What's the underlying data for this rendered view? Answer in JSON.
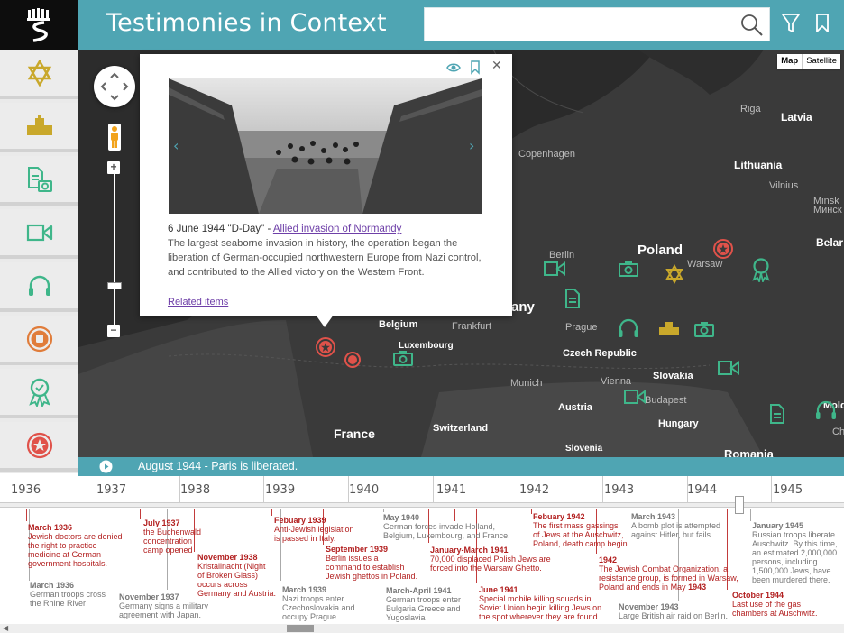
{
  "header": {
    "title": "Testimonies in Context",
    "search_placeholder": ""
  },
  "sidebar": {
    "items": [
      {
        "icon": "star-of-david-icon"
      },
      {
        "icon": "building-icon"
      },
      {
        "icon": "document-photo-icon"
      },
      {
        "icon": "video-icon"
      },
      {
        "icon": "headphones-icon"
      },
      {
        "icon": "fist-badge-icon"
      },
      {
        "icon": "ribbon-award-icon"
      },
      {
        "icon": "star-badge-icon"
      }
    ]
  },
  "map": {
    "toggle": {
      "map": "Map",
      "satellite": "Satellite"
    },
    "labels": {
      "riga": "Riga",
      "latvia": "Latvia",
      "copenhagen": "Copenhagen",
      "lithuania": "Lithuania",
      "vilnius": "Vilnius",
      "minsk": "Minsk",
      "minsk_ru": "Минск",
      "belarus": "Belar",
      "berlin": "Berlin",
      "poland": "Poland",
      "warsaw": "Warsaw",
      "germany": "any",
      "belgium": "Belgium",
      "frankfurt": "Frankfurt",
      "prague": "Prague",
      "luxembourg": "Luxembourg",
      "czech": "Czech Republic",
      "slovakia": "Slovakia",
      "munich": "Munich",
      "vienna": "Vienna",
      "budapest": "Budapest",
      "austria": "Austria",
      "hungary": "Hungary",
      "switzerland": "Switzerland",
      "france": "France",
      "slovenia": "Slovenia",
      "romania": "Romania",
      "moldova": "Mold",
      "chisinau": "Chi"
    }
  },
  "popup": {
    "date": "6 June 1944 \"D-Day\" - ",
    "link": "Allied invasion of Normandy",
    "description": "The largest seaborne invasion in history, the operation began the liberation of German-occupied northwestern Europe from Nazi control, and contributed to the Allied victory on the Western Front.",
    "related": "Related items",
    "close": "✕"
  },
  "playbar": {
    "text": "August 1944 - Paris is liberated."
  },
  "timeline": {
    "years": [
      "1936",
      "1937",
      "1938",
      "1939",
      "1940",
      "1941",
      "1942",
      "1943",
      "1944",
      "1945"
    ],
    "events": {
      "e1_date": "March 1936",
      "e1_text": [
        "Jewish doctors are denied",
        "the right to practice",
        "medicine at German",
        "government hospitals."
      ],
      "e2_date": "March 1936",
      "e2_text": [
        "German troops cross",
        "the Rhine River"
      ],
      "e3_date": "July 1937",
      "e3_text": [
        "the Buchenwald",
        "concentration",
        "camp opened"
      ],
      "e4_date": "November 1937",
      "e4_text": [
        "Germany signs a military",
        "agreement with Japan."
      ],
      "e5_date": "November 1938",
      "e5_text": [
        "Kristallnacht (Night",
        "of Broken Glass)",
        "occurs across",
        "Germany and Austria."
      ],
      "e6_date": "Febuary 1939",
      "e6_text": [
        "Anti-Jewish legislation",
        "is passed in Italy."
      ],
      "e7_date": "September 1939",
      "e7_text": [
        "Berlin issues a",
        "command to establish",
        "Jewish ghettos in Poland."
      ],
      "e8_date": "March 1939",
      "e8_text": [
        "Nazi troops enter",
        "Czechoslovakia and",
        "occupy Prague."
      ],
      "e9_date": "May 1940",
      "e9_text": [
        "German forces invade Holland,",
        "Belgium, Luxembourg, and France."
      ],
      "e10_date": "January-March 1941",
      "e10_text": [
        "70,000 displaced Polish Jews are",
        "forced into the Warsaw Ghetto."
      ],
      "e11_date": "March-April 1941",
      "e11_text": [
        "German troops enter",
        "Bulgaria Greece and",
        "Yugoslavia"
      ],
      "e12_date": "June 1941",
      "e12_text": [
        "Special mobile killing squads in",
        "Soviet Union begin killing Jews on",
        "the spot wherever they are found"
      ],
      "e13_date": "Febuary 1942",
      "e13_text": [
        "The first mass gassings",
        "of Jews at the Auschwitz,",
        "Poland, death camp begin"
      ],
      "e14_date": "1942",
      "e14_text": [
        "The Jewish Combat Organization, a",
        "resistance group, is formed in Warsaw,",
        "Poland and ends in May"
      ],
      "e14_bold": "1943",
      "e15_date": "March 1943",
      "e15_text": [
        "A bomb plot is attempted",
        "against Hitler, but fails"
      ],
      "e16_date": "November 1943",
      "e16_text": [
        "Large British air raid on Berlin."
      ],
      "e17_date": "January 1945",
      "e17_text": [
        "Russian troops liberate",
        "Auschwitz. By this time,",
        "an estimated 2,000,000",
        "persons, including",
        "1,500,000 Jews, have",
        "been murdered there."
      ],
      "e18_date": "October 1944",
      "e18_text": [
        "Last use of the gas",
        "chambers at Auschwitz."
      ]
    }
  },
  "colors": {
    "teal": "#4fa5b3",
    "gold": "#c9a82b",
    "green": "#3fb68a",
    "orange": "#e07c3a",
    "red": "#e0524a",
    "event_red": "#b21f1f"
  }
}
